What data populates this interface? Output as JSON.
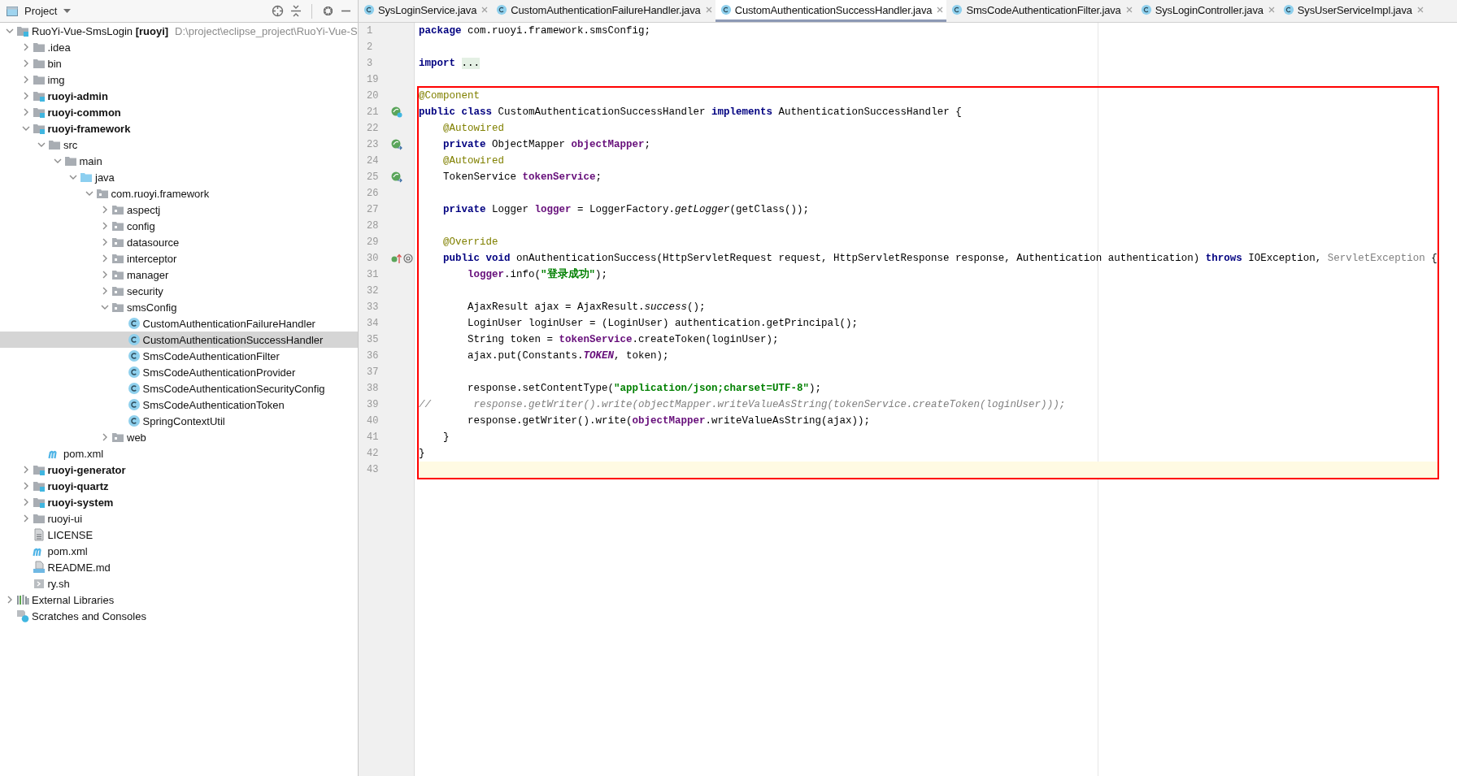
{
  "project_panel": {
    "title": "Project"
  },
  "project_tree": [
    {
      "label": "RuoYi-Vue-SmsLogin **[ruoyi]**",
      "hint": "D:\\project\\eclipse_project\\RuoYi-Vue-S",
      "kind": "project",
      "expanded": true,
      "selected": false,
      "children": [
        {
          "label": ".idea",
          "kind": "folder",
          "expanded": false,
          "selected": false
        },
        {
          "label": "bin",
          "kind": "folder",
          "expanded": false,
          "selected": false
        },
        {
          "label": "img",
          "kind": "folder",
          "expanded": false,
          "selected": false
        },
        {
          "label": "ruoyi-admin",
          "kind": "module",
          "expanded": false,
          "selected": false
        },
        {
          "label": "ruoyi-common",
          "kind": "module",
          "expanded": false,
          "selected": false
        },
        {
          "label": "ruoyi-framework",
          "kind": "module",
          "expanded": true,
          "selected": false,
          "children": [
            {
              "label": "src",
              "kind": "folder",
              "expanded": true,
              "selected": false,
              "children": [
                {
                  "label": "main",
                  "kind": "folder",
                  "expanded": true,
                  "selected": false,
                  "children": [
                    {
                      "label": "java",
                      "kind": "source",
                      "expanded": true,
                      "selected": false,
                      "children": [
                        {
                          "label": "com.ruoyi.framework",
                          "kind": "package",
                          "expanded": true,
                          "selected": false,
                          "children": [
                            {
                              "label": "aspectj",
                              "kind": "package",
                              "expanded": false,
                              "selected": false
                            },
                            {
                              "label": "config",
                              "kind": "package",
                              "expanded": false,
                              "selected": false
                            },
                            {
                              "label": "datasource",
                              "kind": "package",
                              "expanded": false,
                              "selected": false
                            },
                            {
                              "label": "interceptor",
                              "kind": "package",
                              "expanded": false,
                              "selected": false
                            },
                            {
                              "label": "manager",
                              "kind": "package",
                              "expanded": false,
                              "selected": false
                            },
                            {
                              "label": "security",
                              "kind": "package",
                              "expanded": false,
                              "selected": false
                            },
                            {
                              "label": "smsConfig",
                              "kind": "package",
                              "expanded": true,
                              "selected": false,
                              "children": [
                                {
                                  "label": "CustomAuthenticationFailureHandler",
                                  "kind": "class",
                                  "selected": false
                                },
                                {
                                  "label": "CustomAuthenticationSuccessHandler",
                                  "kind": "class",
                                  "selected": true
                                },
                                {
                                  "label": "SmsCodeAuthenticationFilter",
                                  "kind": "class",
                                  "selected": false
                                },
                                {
                                  "label": "SmsCodeAuthenticationProvider",
                                  "kind": "class",
                                  "selected": false
                                },
                                {
                                  "label": "SmsCodeAuthenticationSecurityConfig",
                                  "kind": "class",
                                  "selected": false
                                },
                                {
                                  "label": "SmsCodeAuthenticationToken",
                                  "kind": "class",
                                  "selected": false
                                },
                                {
                                  "label": "SpringContextUtil",
                                  "kind": "class",
                                  "selected": false
                                }
                              ]
                            },
                            {
                              "label": "web",
                              "kind": "package",
                              "expanded": false,
                              "selected": false
                            }
                          ]
                        }
                      ]
                    }
                  ]
                }
              ]
            },
            {
              "label": "pom.xml",
              "kind": "maven",
              "selected": false
            }
          ]
        },
        {
          "label": "ruoyi-generator",
          "kind": "module",
          "expanded": false,
          "selected": false
        },
        {
          "label": "ruoyi-quartz",
          "kind": "module",
          "expanded": false,
          "selected": false
        },
        {
          "label": "ruoyi-system",
          "kind": "module",
          "expanded": false,
          "selected": false
        },
        {
          "label": "ruoyi-ui",
          "kind": "folder",
          "expanded": false,
          "selected": false
        },
        {
          "label": "LICENSE",
          "kind": "text",
          "selected": false
        },
        {
          "label": "pom.xml",
          "kind": "maven",
          "selected": false
        },
        {
          "label": "README.md",
          "kind": "markdown",
          "selected": false
        },
        {
          "label": "ry.sh",
          "kind": "shell",
          "selected": false
        }
      ]
    },
    {
      "label": "External Libraries",
      "kind": "libraries",
      "expanded": false,
      "selected": false
    },
    {
      "label": "Scratches and Consoles",
      "kind": "scratches",
      "selected": false
    }
  ],
  "tabs": [
    {
      "label": "SysLoginService.java",
      "selected": false
    },
    {
      "label": "CustomAuthenticationFailureHandler.java",
      "selected": false
    },
    {
      "label": "CustomAuthenticationSuccessHandler.java",
      "selected": true
    },
    {
      "label": "SmsCodeAuthenticationFilter.java",
      "selected": false
    },
    {
      "label": "SysLoginController.java",
      "selected": false
    },
    {
      "label": "SysUserServiceImpl.java",
      "selected": false
    }
  ],
  "editor": {
    "lines": [
      {
        "number": "1",
        "current": false,
        "tokens": [
          {
            "text": "package",
            "kind": "keyword"
          },
          {
            "text": " com.ruoyi.framework.smsConfig;",
            "kind": "plain"
          }
        ]
      },
      {
        "number": "2",
        "current": false
      },
      {
        "number": "3",
        "current": false,
        "tokens": [
          {
            "text": "import ",
            "kind": "keyword"
          },
          {
            "text": "...",
            "kind": "folded"
          }
        ]
      },
      {
        "number": "19",
        "current": false
      }
    ],
    "annotation_box": {
      "lines": [
        {
          "number": "20",
          "current": false,
          "tokens": [
            {
              "text": "@Component",
              "kind": "annotation"
            }
          ]
        },
        {
          "number": "21",
          "kind": "bean-class",
          "current": false,
          "tokens": [
            {
              "text": "public",
              "kind": "keyword"
            },
            {
              "text": " class",
              "kind": "keyword"
            },
            {
              "text": " CustomAuthenticationSuccessHandler ",
              "kind": "plain"
            },
            {
              "text": "implements",
              "kind": "keyword"
            },
            {
              "text": " AuthenticationSuccessHandler {",
              "kind": "plain"
            }
          ]
        },
        {
          "number": "22",
          "current": false,
          "tokens": [
            {
              "text": "    @Autowired",
              "kind": "annotation"
            }
          ]
        },
        {
          "number": "23",
          "kind": "bean-link",
          "current": false,
          "tokens": [
            {
              "text": "    private",
              "kind": "keyword"
            },
            {
              "text": " ObjectMapper ",
              "kind": "plain"
            },
            {
              "text": "objectMapper",
              "kind": "field"
            },
            {
              "text": ";",
              "kind": "plain"
            }
          ]
        },
        {
          "number": "24",
          "current": false,
          "tokens": [
            {
              "text": "    @Autowired",
              "kind": "annotation"
            }
          ]
        },
        {
          "number": "25",
          "kind": "bean-link",
          "current": false,
          "tokens": [
            {
              "text": "    TokenService ",
              "kind": "plain"
            },
            {
              "text": "tokenService",
              "kind": "field"
            },
            {
              "text": ";",
              "kind": "plain"
            }
          ]
        },
        {
          "number": "26",
          "current": false
        },
        {
          "number": "27",
          "current": false,
          "tokens": [
            {
              "text": "    private",
              "kind": "keyword"
            },
            {
              "text": " Logger ",
              "kind": "plain"
            },
            {
              "text": "logger",
              "kind": "field"
            },
            {
              "text": " = LoggerFactory.",
              "kind": "plain"
            },
            {
              "text": "getLogger",
              "kind": "static"
            },
            {
              "text": "(getClass());",
              "kind": "plain"
            }
          ]
        },
        {
          "number": "28",
          "current": false
        },
        {
          "number": "29",
          "current": false,
          "tokens": [
            {
              "text": "    @Override",
              "kind": "annotation"
            }
          ]
        },
        {
          "number": "30",
          "kind": "override",
          "current": false,
          "tokens": [
            {
              "text": "    public",
              "kind": "keyword"
            },
            {
              "text": " void",
              "kind": "keyword"
            },
            {
              "text": " onAuthenticationSuccess(HttpServletRequest request, HttpServletResponse response, Authentication authentication) ",
              "kind": "plain"
            },
            {
              "text": "throws",
              "kind": "keyword"
            },
            {
              "text": " IOException, ",
              "kind": "plain"
            },
            {
              "text": "ServletException",
              "kind": "unused"
            },
            {
              "text": " {",
              "kind": "plain"
            }
          ]
        },
        {
          "number": "31",
          "current": false,
          "tokens": [
            {
              "text": "        logger",
              "kind": "field"
            },
            {
              "text": ".info(",
              "kind": "plain"
            },
            {
              "text": "\"登录成功\"",
              "kind": "string"
            },
            {
              "text": ");",
              "kind": "plain"
            }
          ]
        },
        {
          "number": "32",
          "current": false
        },
        {
          "number": "33",
          "current": false,
          "tokens": [
            {
              "text": "        AjaxResult ajax = AjaxResult.",
              "kind": "plain"
            },
            {
              "text": "success",
              "kind": "static"
            },
            {
              "text": "();",
              "kind": "plain"
            }
          ]
        },
        {
          "number": "34",
          "current": false,
          "tokens": [
            {
              "text": "        LoginUser loginUser = (LoginUser) authentication.getPrincipal();",
              "kind": "plain"
            }
          ]
        },
        {
          "number": "35",
          "current": false,
          "tokens": [
            {
              "text": "        String token = ",
              "kind": "plain"
            },
            {
              "text": "tokenService",
              "kind": "field"
            },
            {
              "text": ".createToken(loginUser);",
              "kind": "plain"
            }
          ]
        },
        {
          "number": "36",
          "current": false,
          "tokens": [
            {
              "text": "        ajax.put(Constants.",
              "kind": "plain"
            },
            {
              "text": "TOKEN",
              "kind": "constant"
            },
            {
              "text": ", token);",
              "kind": "plain"
            }
          ]
        },
        {
          "number": "37",
          "current": false
        },
        {
          "number": "38",
          "current": false,
          "tokens": [
            {
              "text": "        response.setContentType(",
              "kind": "plain"
            },
            {
              "text": "\"application/json;charset=UTF-8\"",
              "kind": "string"
            },
            {
              "text": ");",
              "kind": "plain"
            }
          ]
        },
        {
          "number": "39",
          "current": false,
          "tokens": [
            {
              "text": "//       response.getWriter().write(objectMapper.writeValueAsString(tokenService.createToken(loginUser)));",
              "kind": "comment"
            }
          ]
        },
        {
          "number": "40",
          "current": false,
          "tokens": [
            {
              "text": "        response.getWriter().write(",
              "kind": "plain"
            },
            {
              "text": "objectMapper",
              "kind": "field"
            },
            {
              "text": ".writeValueAsString(ajax));",
              "kind": "plain"
            }
          ]
        },
        {
          "number": "41",
          "current": false,
          "tokens": [
            {
              "text": "    }",
              "kind": "plain"
            }
          ]
        },
        {
          "number": "42",
          "current": false,
          "tokens": [
            {
              "text": "}",
              "kind": "plain"
            }
          ]
        },
        {
          "number": "43",
          "current": true
        }
      ]
    }
  }
}
